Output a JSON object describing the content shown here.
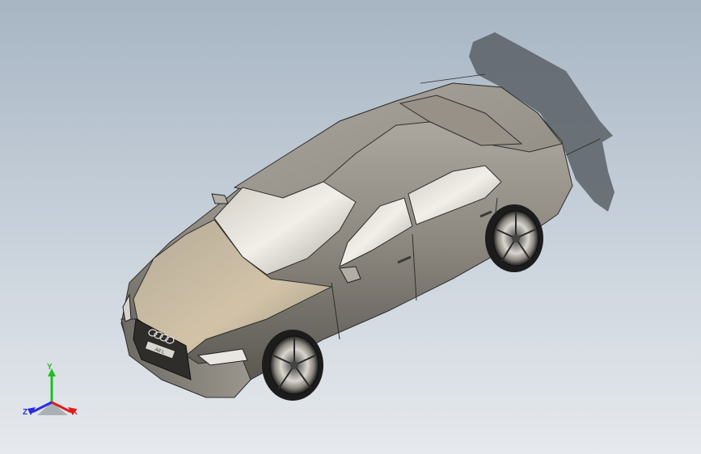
{
  "viewport": {
    "background_top": "#a7b5c3",
    "background_bottom": "#e6e9ed",
    "model": {
      "body_color": "#a39e94",
      "hood_color": "#c2b49b",
      "shadow_color": "#555a60",
      "grille_badge": "A8 L"
    }
  },
  "triad": {
    "labels": {
      "x": "X",
      "y": "Y",
      "z": "Z"
    },
    "colors": {
      "x": "#e01b1b",
      "y": "#1fbf1f",
      "z": "#2a2ae0"
    }
  }
}
